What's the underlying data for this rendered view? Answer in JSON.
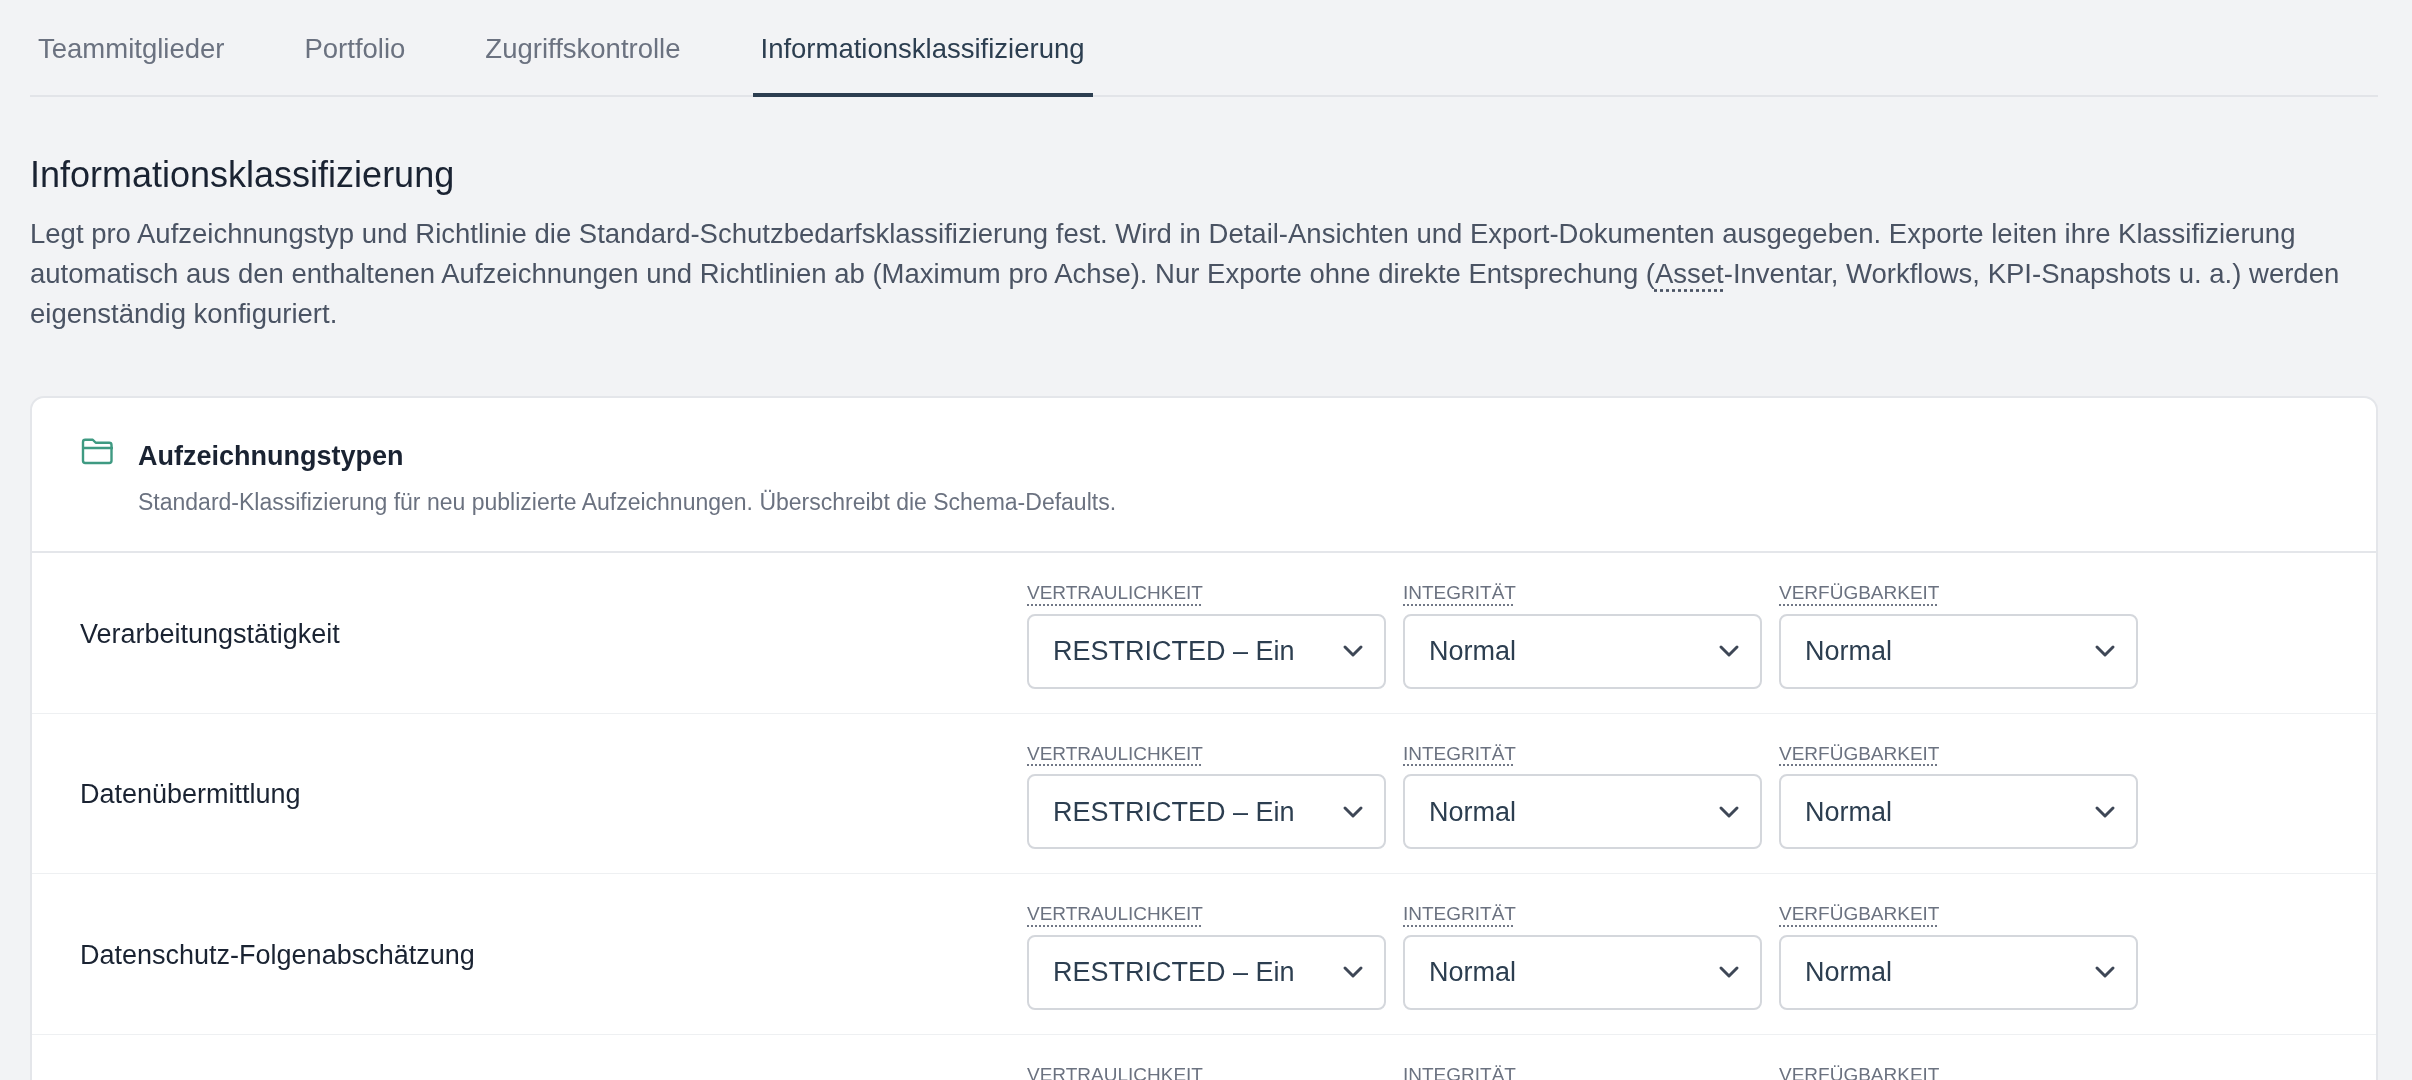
{
  "tabs": [
    {
      "label": "Teammitglieder",
      "selected": false
    },
    {
      "label": "Portfolio",
      "selected": false
    },
    {
      "label": "Zugriffskontrolle",
      "selected": false
    },
    {
      "label": "Informationsklassifizierung",
      "selected": true
    }
  ],
  "heading": "Informationsklassifizierung",
  "description": [
    {
      "kind": "text",
      "text": "Legt pro Aufzeichnungstyp und Richtlinie die Standard-Schutzbedarfsklassifizierung fest. Wird in Detail-Ansichten und Export-Dokumenten ausgegeben. Exporte leiten ihre Klassifizierung automatisch aus den enthaltenen Aufzeichnungen und Richtlinien ab (Maximum pro Achse). Nur Exporte ohne direkte Entsprechung ("
    },
    {
      "kind": "abbr",
      "text": "Asset"
    },
    {
      "kind": "text",
      "text": "-Inventar, Workflows, KPI-Snapshots u. a.) werden eigenständig konfiguriert."
    }
  ],
  "card": {
    "title": "Aufzeichnungstypen",
    "subtitle": "Standard-Klassifizierung für neu publizierte Aufzeichnungen. Überschreibt die Schema-Defaults.",
    "rows": [
      {
        "name": "Verarbeitungstätigkeit",
        "fields": [
          {
            "label": "VERTRAULICHKEIT",
            "value": "RESTRICTED – Ein"
          },
          {
            "label": "INTEGRITÄT",
            "value": "Normal"
          },
          {
            "label": "VERFÜGBARKEIT",
            "value": "Normal"
          }
        ]
      },
      {
        "name": "Datenübermittlung",
        "fields": [
          {
            "label": "VERTRAULICHKEIT",
            "value": "RESTRICTED – Ein"
          },
          {
            "label": "INTEGRITÄT",
            "value": "Normal"
          },
          {
            "label": "VERFÜGBARKEIT",
            "value": "Normal"
          }
        ]
      },
      {
        "name": "Datenschutz-Folgenabschätzung",
        "fields": [
          {
            "label": "VERTRAULICHKEIT",
            "value": "RESTRICTED – Ein"
          },
          {
            "label": "INTEGRITÄT",
            "value": "Normal"
          },
          {
            "label": "VERFÜGBARKEIT",
            "value": "Normal"
          }
        ]
      },
      {
        "fields": [
          {
            "label": "VERTRAULICHKEIT"
          },
          {
            "label": "INTEGRITÄT"
          },
          {
            "label": "VERFÜGBARKEIT"
          }
        ]
      }
    ]
  }
}
